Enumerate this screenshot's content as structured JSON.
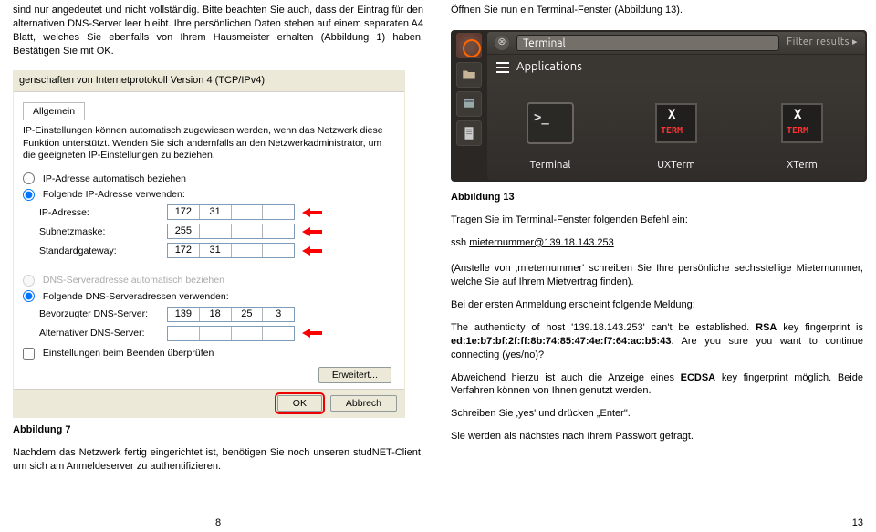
{
  "left": {
    "intro": "sind nur angedeutet und nicht vollständig. Bitte beachten Sie auch, dass der Eintrag für den alternativen DNS-Server leer bleibt. Ihre persönlichen Daten stehen auf einem separaten A4 Blatt, welches Sie ebenfalls von Ihrem Hausmeister erhalten (Abbildung 1) haben. Bestätigen Sie mit OK.",
    "win": {
      "title": "genschaften von Internetprotokoll Version 4 (TCP/IPv4)",
      "tab": "Allgemein",
      "hint": "IP-Einstellungen können automatisch zugewiesen werden, wenn das Netzwerk diese Funktion unterstützt. Wenden Sie sich andernfalls an den Netzwerkadministrator, um die geeigneten IP-Einstellungen zu beziehen.",
      "radio_ip_auto": "IP-Adresse automatisch beziehen",
      "radio_ip_manual": "Folgende IP-Adresse verwenden:",
      "ip_label": "IP-Adresse:",
      "ip_value": [
        "172",
        "31",
        "",
        ""
      ],
      "mask_label": "Subnetzmaske:",
      "mask_value": [
        "255",
        "",
        "",
        ""
      ],
      "gw_label": "Standardgateway:",
      "gw_value": [
        "172",
        "31",
        "",
        ""
      ],
      "radio_dns_auto": "DNS-Serveradresse automatisch beziehen",
      "radio_dns_manual": "Folgende DNS-Serveradressen verwenden:",
      "dns1_label": "Bevorzugter DNS-Server:",
      "dns1_value": [
        "139",
        "18",
        "25",
        "3"
      ],
      "dns2_label": "Alternativer DNS-Server:",
      "dns2_value": [
        "",
        "",
        "",
        ""
      ],
      "chk": "Einstellungen beim Beenden überprüfen",
      "adv": "Erweitert...",
      "ok": "OK",
      "cancel": "Abbrech"
    },
    "caption": "Abbildung 7",
    "after": "Nachdem das Netzwerk fertig eingerichtet ist, benötigen Sie noch unseren studNET-Client, um sich am Anmeldeserver zu authentifizieren."
  },
  "right": {
    "open": "Öffnen Sie nun ein Terminal-Fenster (Abbildung 13).",
    "ub": {
      "search_value": "Terminal",
      "filter": "Filter results ▸",
      "cat": "Applications",
      "tiles": {
        "t1": "Terminal",
        "t2": "UXTerm",
        "t3": "XTerm"
      }
    },
    "caption": "Abbildung 13",
    "type_cmd": "Tragen Sie im Terminal-Fenster folgenden Befehl ein:",
    "ssh_prefix": "ssh ",
    "ssh_link": "mieternummer@139.18.143.253",
    "p_anstelle": "(Anstelle von ‚mieternummer' schreiben Sie Ihre persönliche sechsstellige Mieternummer, welche Sie auf Ihrem Mietvertrag finden).",
    "p_first": "Bei der ersten Anmeldung erscheint folgende Meldung:",
    "p_auth_a": "The authenticity of host '139.18.143.253' can't be established. ",
    "p_auth_b1": "RSA",
    "p_auth_b2": " key fingerprint is ",
    "p_fp": "ed:1e:b7:bf:2f:ff:8b:74:85:47:4e:f7:64:ac:b5:43",
    "p_auth_c": ". Are you sure you want to continue connecting (yes/no)?",
    "p_ecdsa_a": "Abweichend hierzu ist auch die Anzeige eines ",
    "p_ecdsa_b": "ECDSA",
    "p_ecdsa_c": " key fingerprint möglich. Beide Verfahren können von Ihnen genutzt werden.",
    "p_yes": "Schreiben Sie ‚yes' und drücken „Enter\".",
    "p_pw": "Sie werden als nächstes nach Ihrem Passwort gefragt."
  },
  "pagenum": {
    "left": "8",
    "right": "13"
  }
}
